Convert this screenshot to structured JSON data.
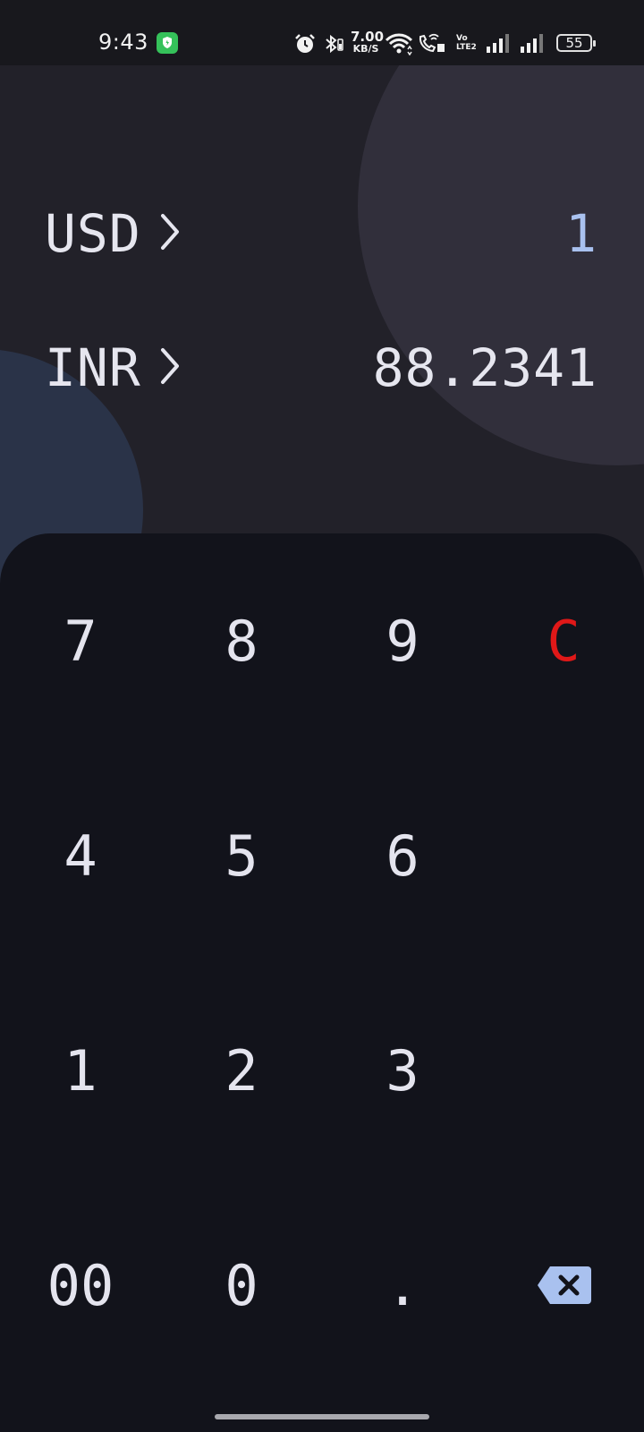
{
  "status_bar": {
    "time": "9:43",
    "net_speed_value": "7.00",
    "net_speed_unit": "KB/S",
    "volte_top": "Vo",
    "volte_bottom": "LTE2",
    "battery": "55",
    "icons": [
      "shield-icon",
      "alarm-icon",
      "bluetooth-icon",
      "wifi-icon",
      "wifi-calling-icon",
      "signal-icon",
      "signal-icon",
      "battery-icon"
    ]
  },
  "converter": {
    "from": {
      "code": "USD",
      "amount": "1"
    },
    "to": {
      "code": "INR",
      "amount": "88.2341"
    }
  },
  "keypad": {
    "k7": "7",
    "k8": "8",
    "k9": "9",
    "clear": "C",
    "k4": "4",
    "k5": "5",
    "k6": "6",
    "k1": "1",
    "k2": "2",
    "k3": "3",
    "k00": "00",
    "k0": "0",
    "dot": ".",
    "backspace_icon": "backspace-icon"
  },
  "colors": {
    "background": "#222129",
    "keypad_background": "#12131b",
    "from_amount": "#a9c1ef",
    "clear_key": "#e01818",
    "backspace": "#a9c1ef"
  }
}
